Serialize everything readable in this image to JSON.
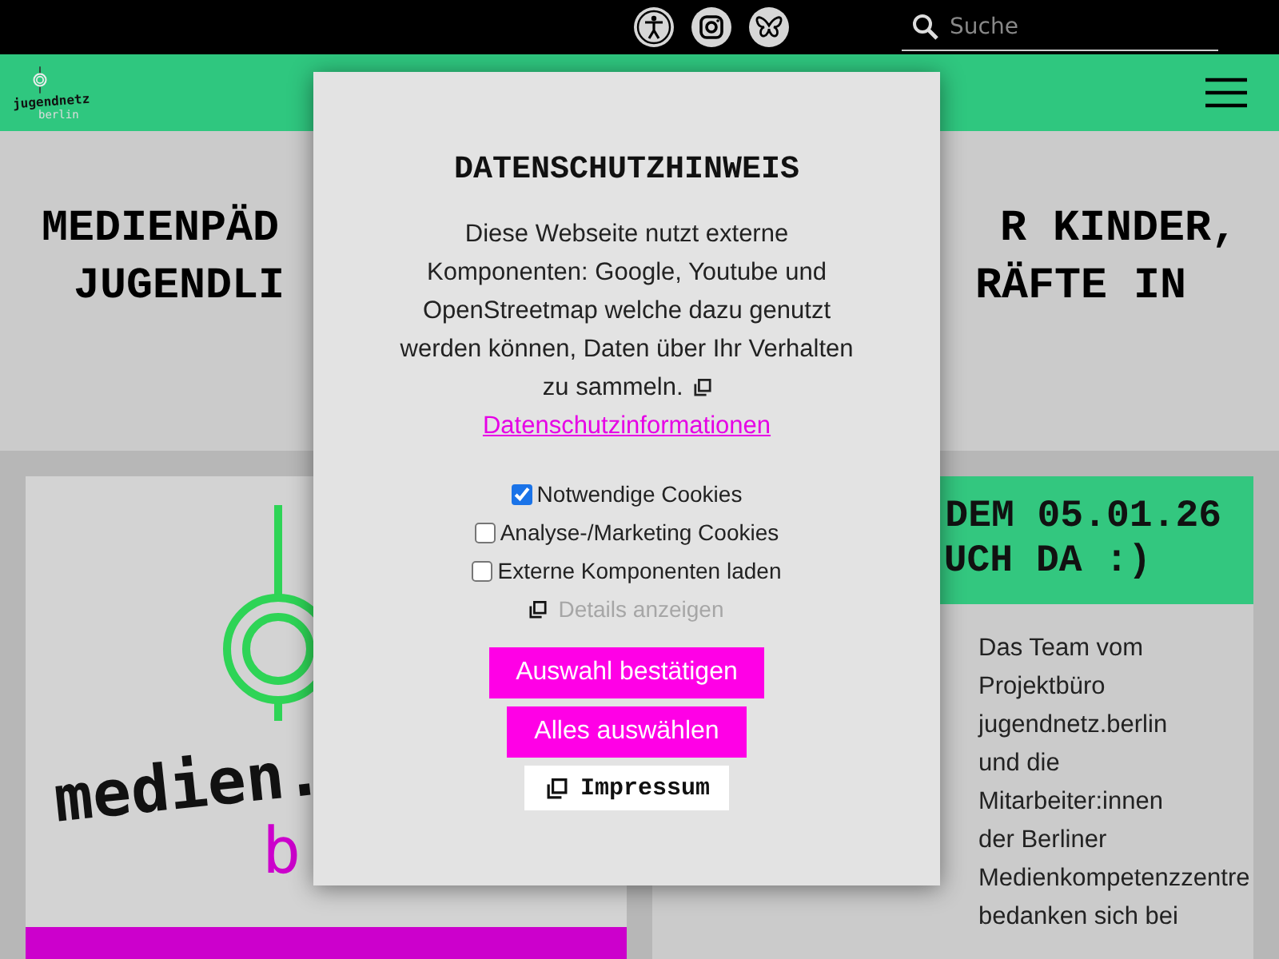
{
  "topbar": {
    "search": {
      "placeholder": "Suche"
    }
  },
  "nav": {
    "logo": {
      "name": "jugendnetz",
      "sub": "berlin"
    }
  },
  "heading": {
    "lines": [
      {
        "left": "MEDIENPÄD",
        "right": "R KINDER,"
      },
      {
        "left": "JUGENDLI",
        "right": "RÄFTE IN"
      }
    ]
  },
  "cards": [
    {
      "kind": "image",
      "logo_words": [
        "medien.",
        "b"
      ]
    },
    {
      "kind": "text",
      "header": [
        "DEM 05.01.26",
        "UCH DA :)"
      ],
      "lines": [
        "Das Team vom",
        "Projektbüro",
        "jugendnetz.berlin",
        "und die",
        "Mitarbeiter:innen",
        "der Berliner",
        "Medienkompetenzzentre",
        "bedanken sich bei"
      ]
    }
  ],
  "dialog": {
    "title": "DATENSCHUTZHINWEIS",
    "text": "Diese Webseite nutzt externe Komponenten: Google, Youtube und OpenStreetmap welche dazu genutzt werden können, Daten über Ihr Verhalten zu sammeln.",
    "link": "Datenschutzinformationen",
    "options": [
      {
        "label": "Notwendige Cookies",
        "checked": true
      },
      {
        "label": "Analyse-/Marketing Cookies",
        "checked": false
      },
      {
        "label": "Externe Komponenten laden",
        "checked": false
      }
    ],
    "details": "Details anzeigen",
    "buttons": [
      {
        "label": "Auswahl bestätigen",
        "kind": "primary"
      },
      {
        "label": "Alles auswählen",
        "kind": "primary"
      },
      {
        "label": "Impressum",
        "kind": "plain"
      }
    ]
  }
}
